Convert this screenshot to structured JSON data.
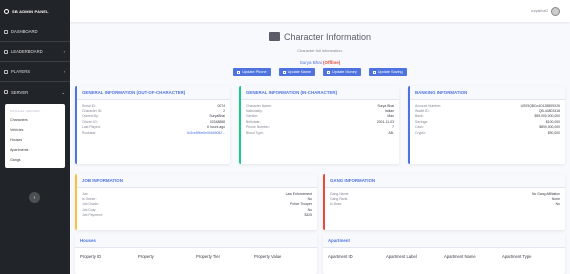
{
  "brand": {
    "title": "SB ADMIN PANEL"
  },
  "user": {
    "name": "suryabhai2"
  },
  "sidebar": {
    "items": [
      {
        "label": "DASHBOARD"
      },
      {
        "label": "LEADERBOARD"
      },
      {
        "label": "PLAYERS"
      },
      {
        "label": "SERVER"
      }
    ],
    "submenu_header": "MANAGE SERVER",
    "submenu": [
      "Characters",
      "Vehicles",
      "Houses",
      "Apartments",
      "Gangs"
    ]
  },
  "page": {
    "title": "Character Information",
    "subtitle": "Character full information.",
    "character_name": "Surya Bhai",
    "status": "(Offline)"
  },
  "buttons": [
    "Update Phone",
    "Update Name",
    "Update Money",
    "Update Saving"
  ],
  "ooc": {
    "title": "GENERAL INFORMATION (OUT-OF-CHARACTER)",
    "rows": [
      [
        "Serial ID:",
        "0074"
      ],
      [
        "Character ID:",
        "2"
      ],
      [
        "Owned By:",
        "SuryaBhai"
      ],
      [
        "Citizen ID:",
        "02348888"
      ],
      [
        "Last Played:",
        "6 hours ago"
      ],
      [
        "Rockstar:",
        "0c3ce89be6e0b6b5082..."
      ]
    ]
  },
  "ic": {
    "title": "GENERAL INFORMATION (IN-CHARACTER)",
    "rows": [
      [
        "Character Name:",
        "Surya Bhai"
      ],
      [
        "Nationality:",
        "Indian"
      ],
      [
        "Gender:",
        "Man"
      ],
      [
        "Birthdate:",
        "2001-11-03"
      ],
      [
        "Phone Number:",
        "7"
      ],
      [
        "Blood Type:",
        "AB-"
      ]
    ]
  },
  "banking": {
    "title": "BANKING INFORMATION",
    "rows": [
      [
        "Account Number:",
        "US09QBCo4D128859X26"
      ],
      [
        "Wallet ID:",
        "QB-44803318"
      ],
      [
        "Bank:",
        "$99,000,000,000"
      ],
      [
        "Savings:",
        "$100,000"
      ],
      [
        "Cash:",
        "$890,000,000"
      ],
      [
        "Crypto:",
        "$90,000"
      ]
    ]
  },
  "job": {
    "title": "JOB INFORMATION",
    "rows": [
      [
        "Job:",
        "Law Enforcement"
      ],
      [
        "Is Owner:",
        "No"
      ],
      [
        "Job Grade:",
        "Police Trooper"
      ],
      [
        "Job Duty:",
        "No"
      ],
      [
        "Job Payment:",
        "$325"
      ]
    ]
  },
  "gang": {
    "title": "GANG INFORMATION",
    "rows": [
      [
        "Gang Name:",
        "No Gang Affiliation"
      ],
      [
        "Gang Rank:",
        "None"
      ],
      [
        "Is Boss:",
        "No"
      ]
    ]
  },
  "houses_section": {
    "title": "Houses & Apartment of Surya Bhai"
  },
  "houses": {
    "title": "Houses",
    "columns": [
      "Property ID",
      "Property",
      "Property Tier",
      "Property Value"
    ]
  },
  "apartment": {
    "title": "Apartment",
    "columns": [
      "Apartment ID",
      "Apartment Label",
      "Apartment Name",
      "Apartment Type"
    ]
  },
  "colors": {
    "primary": "#4e73df",
    "success": "#1cc88a",
    "warning": "#f6c23e",
    "danger": "#e74a3b",
    "sidebar": "#212529"
  }
}
